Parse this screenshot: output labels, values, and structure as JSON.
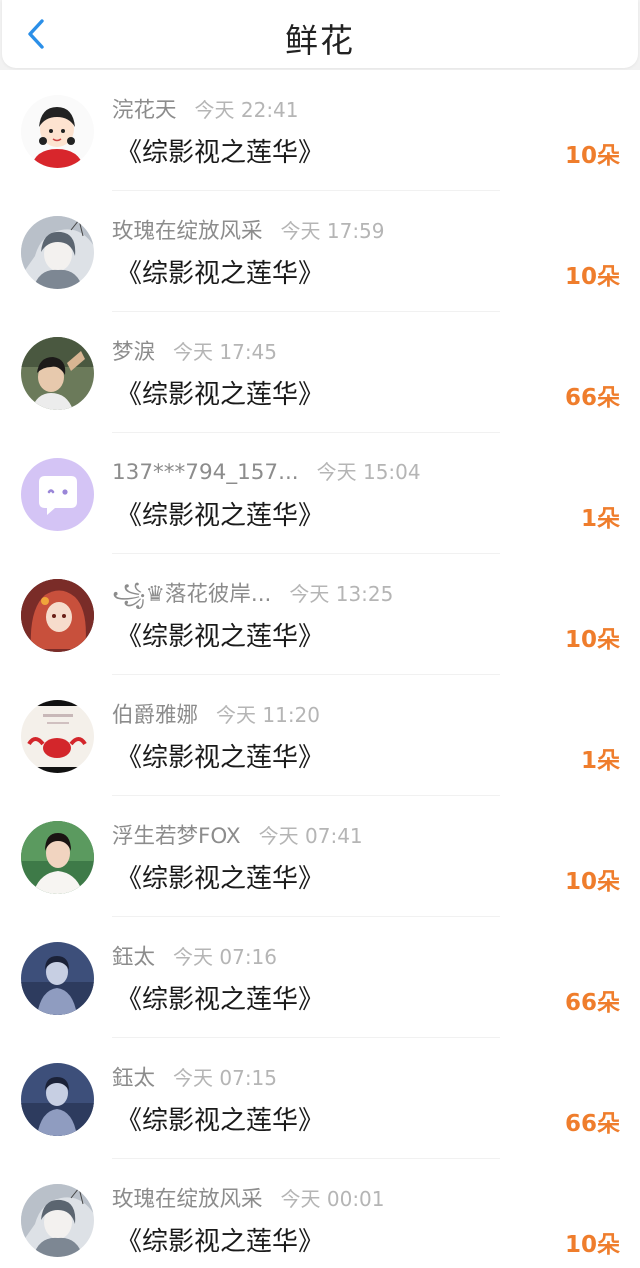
{
  "header": {
    "title": "鲜花",
    "back_icon": "chevron-left-icon",
    "accent": "#2b8fe8"
  },
  "count_color": "#ef7d2c",
  "items": [
    {
      "name": "浣花天",
      "time": "今天 22:41",
      "book": "《综影视之莲华》",
      "count": "10朵",
      "avatar": "cartoon-girl"
    },
    {
      "name": "玫瑰在绽放风采",
      "time": "今天 17:59",
      "book": "《综影视之莲华》",
      "count": "10朵",
      "avatar": "ink-girl"
    },
    {
      "name": "梦淚",
      "time": "今天 17:45",
      "book": "《综影视之莲华》",
      "count": "66朵",
      "avatar": "boy-photo"
    },
    {
      "name": "137***794_157...",
      "time": "今天 15:04",
      "book": "《综影视之莲华》",
      "count": "1朵",
      "avatar": "chat-bubble"
    },
    {
      "name": "꧁♛落花彼岸...",
      "time": "今天 13:25",
      "book": "《综影视之莲华》",
      "count": "10朵",
      "avatar": "red-hair-girl"
    },
    {
      "name": "伯爵雅娜",
      "time": "今天 11:20",
      "book": "《综影视之莲华》",
      "count": "1朵",
      "avatar": "red-cartoon"
    },
    {
      "name": "浮生若梦FOX",
      "time": "今天 07:41",
      "book": "《综影视之莲华》",
      "count": "10朵",
      "avatar": "woman-photo"
    },
    {
      "name": "鈺太",
      "time": "今天 07:16",
      "book": "《综影视之莲华》",
      "count": "66朵",
      "avatar": "blue-boy"
    },
    {
      "name": "鈺太",
      "time": "今天 07:15",
      "book": "《综影视之莲华》",
      "count": "66朵",
      "avatar": "blue-boy"
    },
    {
      "name": "玫瑰在绽放风采",
      "time": "今天 00:01",
      "book": "《综影视之莲华》",
      "count": "10朵",
      "avatar": "ink-girl"
    }
  ]
}
